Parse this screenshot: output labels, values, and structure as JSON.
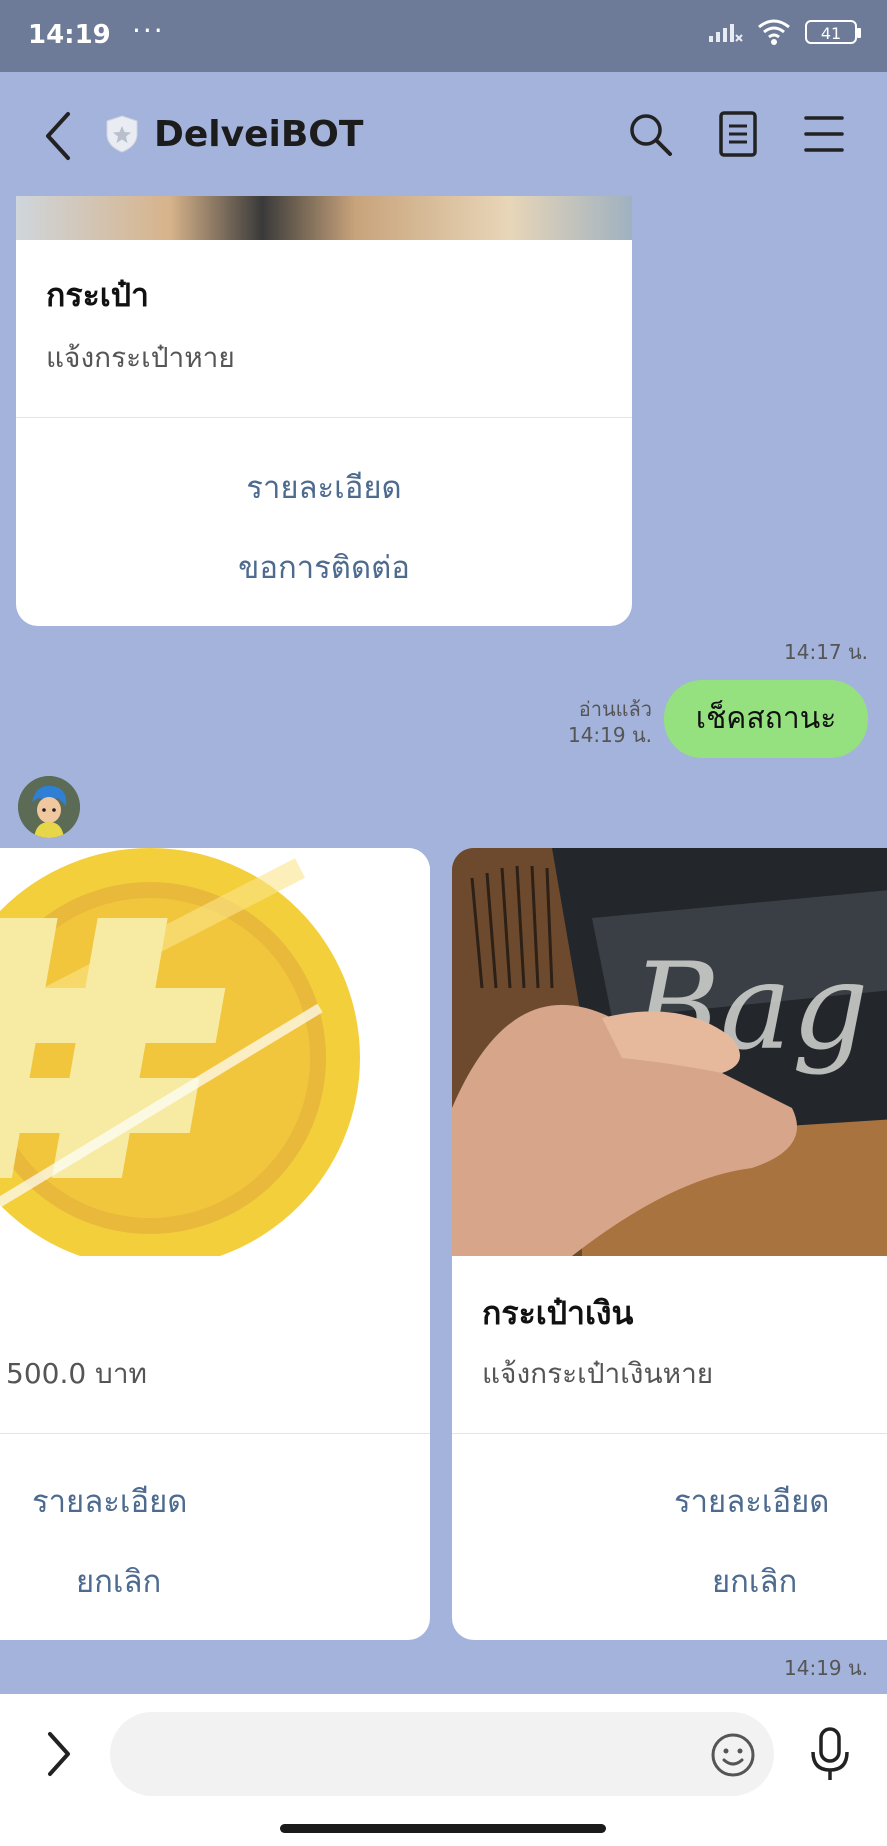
{
  "status_bar": {
    "time": "14:19",
    "dots": "···",
    "battery": "41"
  },
  "header": {
    "title": "DelveiBOT"
  },
  "top_card": {
    "title": "กระเป๋า",
    "subtitle": "แจ้งกระเป๋าหาย",
    "action_details": "รายละเอียด",
    "action_contact": "ขอการติดต่อ"
  },
  "time_top_card": "14:17 น.",
  "outgoing": {
    "text": "เช็คสถานะ",
    "read": "อ่านแล้ว",
    "time": "14:19 น."
  },
  "carousel": [
    {
      "subtitle": "500.0 บาท",
      "action_details": "รายละเอียด",
      "action_cancel": "ยกเลิก",
      "image_icon": "baht-coin"
    },
    {
      "title": "กระเป๋าเงิน",
      "subtitle": "แจ้งกระเป๋าเงินหาย",
      "action_details": "รายละเอียด",
      "action_cancel": "ยกเลิก",
      "image_icon": "wallet-photo"
    }
  ],
  "time_carousel": "14:19 น.",
  "colors": {
    "outgoing_bubble": "#95e17f",
    "action_text": "#4d6a8f",
    "background": "#a3b3dc"
  }
}
